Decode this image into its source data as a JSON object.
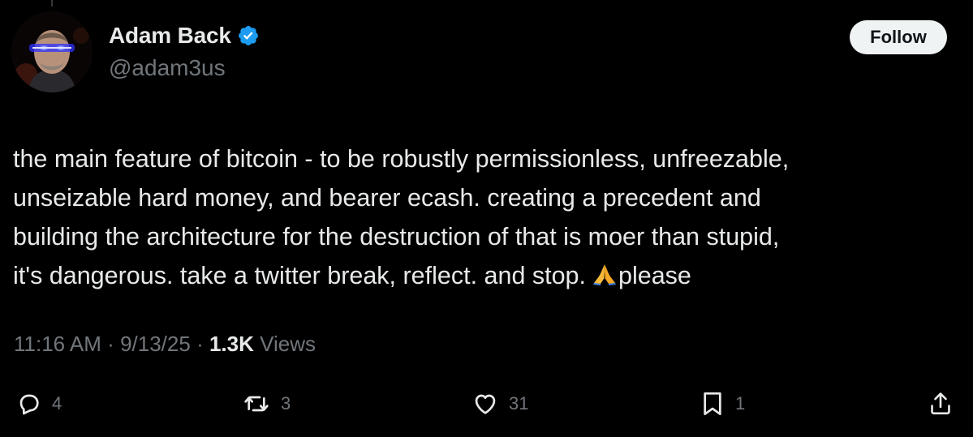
{
  "author": {
    "display_name": "Adam Back",
    "handle": "@adam3us",
    "verified": true
  },
  "follow_button": "Follow",
  "tweet": {
    "lines": [
      "the main feature of bitcoin - to be robustly permissionless, unfreezable,",
      "unseizable hard money, and bearer ecash. creating a precedent and",
      "building the architecture for the destruction of that is moer than stupid,",
      "it's dangerous. take a twitter break, reflect. and stop."
    ],
    "emoji": "🙏",
    "after_emoji": "please"
  },
  "meta": {
    "time": "11:16 AM",
    "separator": "·",
    "date": "9/13/25",
    "views_count": "1.3K",
    "views_label": "Views"
  },
  "actions": {
    "replies": "4",
    "reposts": "3",
    "likes": "31",
    "bookmarks": "1"
  },
  "icons": {
    "verified": "verified-badge-icon",
    "reply": "reply-icon",
    "repost": "repost-icon",
    "like": "heart-icon",
    "bookmark": "bookmark-icon",
    "share": "share-icon",
    "emoji": "folded-hands-icon"
  },
  "colors": {
    "background": "#000000",
    "text_primary": "#e7e9ea",
    "text_secondary": "#71767b",
    "verified_blue": "#1d9bf0",
    "follow_bg": "#eff3f4",
    "follow_text": "#0f1419"
  }
}
